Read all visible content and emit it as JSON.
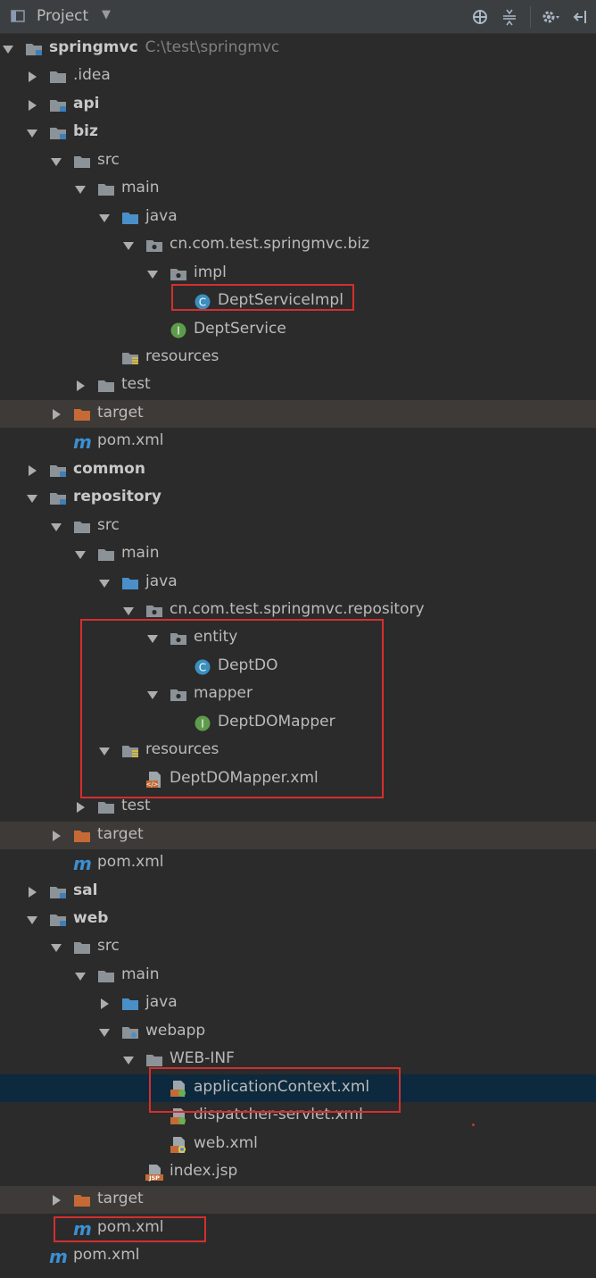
{
  "header": {
    "title": "Project"
  },
  "tree": [
    {
      "id": "springmvc",
      "label": "springmvc",
      "path": "C:\\test\\springmvc",
      "bold": true,
      "arrow": "down",
      "icon": "module-folder",
      "depth": 0
    },
    {
      "id": "idea",
      "label": ".idea",
      "arrow": "right",
      "icon": "folder",
      "depth": 1
    },
    {
      "id": "api",
      "label": "api",
      "bold": true,
      "arrow": "right",
      "icon": "module-folder",
      "depth": 1
    },
    {
      "id": "biz",
      "label": "biz",
      "bold": true,
      "arrow": "down",
      "icon": "module-folder",
      "depth": 1
    },
    {
      "id": "biz-src",
      "label": "src",
      "arrow": "down",
      "icon": "folder",
      "depth": 2
    },
    {
      "id": "biz-main",
      "label": "main",
      "arrow": "down",
      "icon": "folder",
      "depth": 3
    },
    {
      "id": "biz-java",
      "label": "java",
      "arrow": "down",
      "icon": "source-folder",
      "depth": 4
    },
    {
      "id": "biz-pkg",
      "label": "cn.com.test.springmvc.biz",
      "arrow": "down",
      "icon": "package",
      "depth": 5
    },
    {
      "id": "biz-impl",
      "label": "impl",
      "arrow": "down",
      "icon": "package",
      "depth": 6
    },
    {
      "id": "dept-service-impl",
      "label": "DeptServiceImpl",
      "arrow": "none",
      "icon": "class",
      "depth": 7
    },
    {
      "id": "dept-service",
      "label": "DeptService",
      "arrow": "none",
      "icon": "interface",
      "depth": 6
    },
    {
      "id": "biz-resources",
      "label": "resources",
      "arrow": "none",
      "icon": "resources-folder",
      "depth": 4
    },
    {
      "id": "biz-test",
      "label": "test",
      "arrow": "right",
      "icon": "folder",
      "depth": 3
    },
    {
      "id": "biz-target",
      "label": "target",
      "arrow": "right",
      "icon": "excluded-folder",
      "depth": 2,
      "excluded": true
    },
    {
      "id": "biz-pom",
      "label": "pom.xml",
      "arrow": "none",
      "icon": "maven",
      "depth": 2
    },
    {
      "id": "common",
      "label": "common",
      "bold": true,
      "arrow": "right",
      "icon": "module-folder",
      "depth": 1
    },
    {
      "id": "repository",
      "label": "repository",
      "bold": true,
      "arrow": "down",
      "icon": "module-folder",
      "depth": 1
    },
    {
      "id": "repo-src",
      "label": "src",
      "arrow": "down",
      "icon": "folder",
      "depth": 2
    },
    {
      "id": "repo-main",
      "label": "main",
      "arrow": "down",
      "icon": "folder",
      "depth": 3
    },
    {
      "id": "repo-java",
      "label": "java",
      "arrow": "down",
      "icon": "source-folder",
      "depth": 4
    },
    {
      "id": "repo-pkg",
      "label": "cn.com.test.springmvc.repository",
      "arrow": "down",
      "icon": "package",
      "depth": 5
    },
    {
      "id": "repo-entity",
      "label": "entity",
      "arrow": "down",
      "icon": "package",
      "depth": 6
    },
    {
      "id": "dept-do",
      "label": "DeptDO",
      "arrow": "none",
      "icon": "class",
      "depth": 7
    },
    {
      "id": "repo-mapper",
      "label": "mapper",
      "arrow": "down",
      "icon": "package",
      "depth": 6
    },
    {
      "id": "dept-do-mapper",
      "label": "DeptDOMapper",
      "arrow": "none",
      "icon": "interface",
      "depth": 7
    },
    {
      "id": "repo-resources",
      "label": "resources",
      "arrow": "down",
      "icon": "resources-folder",
      "depth": 4
    },
    {
      "id": "dept-do-mapper-xml",
      "label": "DeptDOMapper.xml",
      "arrow": "none",
      "icon": "xml-file",
      "depth": 5
    },
    {
      "id": "repo-test",
      "label": "test",
      "arrow": "right",
      "icon": "folder",
      "depth": 3
    },
    {
      "id": "repo-target",
      "label": "target",
      "arrow": "right",
      "icon": "excluded-folder",
      "depth": 2,
      "excluded": true
    },
    {
      "id": "repo-pom",
      "label": "pom.xml",
      "arrow": "none",
      "icon": "maven",
      "depth": 2
    },
    {
      "id": "sal",
      "label": "sal",
      "bold": true,
      "arrow": "right",
      "icon": "module-folder",
      "depth": 1
    },
    {
      "id": "web",
      "label": "web",
      "bold": true,
      "arrow": "down",
      "icon": "module-folder",
      "depth": 1
    },
    {
      "id": "web-src",
      "label": "src",
      "arrow": "down",
      "icon": "folder",
      "depth": 2
    },
    {
      "id": "web-main",
      "label": "main",
      "arrow": "down",
      "icon": "folder",
      "depth": 3
    },
    {
      "id": "web-java",
      "label": "java",
      "arrow": "right",
      "icon": "source-folder",
      "depth": 4
    },
    {
      "id": "web-webapp",
      "label": "webapp",
      "arrow": "down",
      "icon": "web-folder",
      "depth": 4
    },
    {
      "id": "web-inf",
      "label": "WEB-INF",
      "arrow": "down",
      "icon": "folder",
      "depth": 5
    },
    {
      "id": "application-context",
      "label": "applicationContext.xml",
      "arrow": "none",
      "icon": "spring-xml",
      "depth": 6,
      "selected": true
    },
    {
      "id": "dispatcher-servlet",
      "label": "dispatcher-servlet.xml",
      "arrow": "none",
      "icon": "spring-xml",
      "depth": 6
    },
    {
      "id": "web-xml",
      "label": "web.xml",
      "arrow": "none",
      "icon": "web-xml",
      "depth": 6
    },
    {
      "id": "index-jsp",
      "label": "index.jsp",
      "arrow": "none",
      "icon": "jsp",
      "depth": 5
    },
    {
      "id": "web-target",
      "label": "target",
      "arrow": "right",
      "icon": "excluded-folder",
      "depth": 2,
      "excluded": true
    },
    {
      "id": "web-pom",
      "label": "pom.xml",
      "arrow": "none",
      "icon": "maven",
      "depth": 2
    },
    {
      "id": "root-pom",
      "label": "pom.xml",
      "arrow": "none",
      "icon": "maven",
      "depth": 1
    }
  ],
  "colors": {
    "panel_bg": "#2b2b2b",
    "header_bg": "#3c3f41",
    "selected_row": "#0d293e",
    "excluded_row": "#3d3a37",
    "text": "#bbbbbb",
    "highlight_box": "#d32f2f"
  }
}
